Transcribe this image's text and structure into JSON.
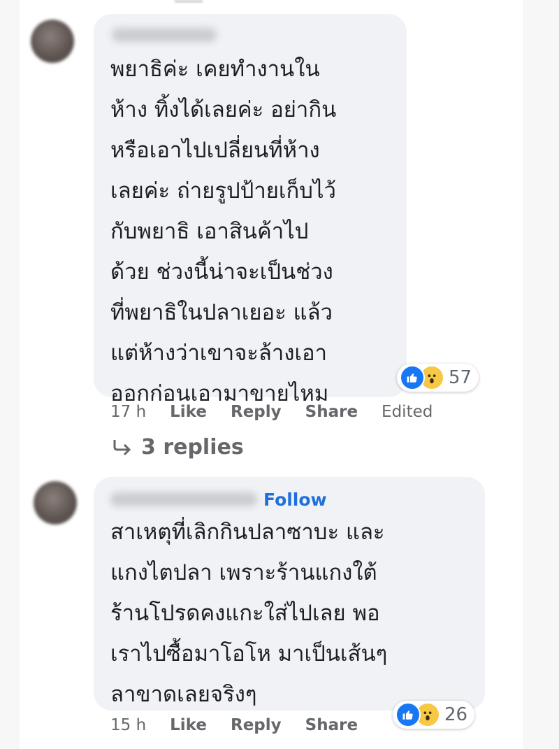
{
  "comments": [
    {
      "text": "พยาธิค่ะ เคยทำงานใน\nห้าง ทิ้งได้เลยค่ะ อย่ากิน\nหรือเอาไปเปลี่ยนที่ห้าง\nเลยค่ะ ถ่ายรูปป้ายเก็บไว้\nกับพยาธิ เอาสินค้าไป\nด้วย ช่วงนี้น่าจะเป็นช่วง\nที่พยาธิในปลาเยอะ แล้ว\nแต่ห้างว่าเขาจะล้างเอา\nออกก่อนเอามาขายไหม",
      "reaction_count": "57",
      "reaction_icons": [
        "like-icon",
        "wow-icon"
      ],
      "time": "17 h",
      "like_label": "Like",
      "reply_label": "Reply",
      "share_label": "Share",
      "edited_label": "Edited",
      "replies_label": "3 replies"
    },
    {
      "follow_label": "Follow",
      "text": "สาเหตุที่เลิกกินปลาซาบะ และ\nแกงไตปลา เพราะร้านแกงใต้\nร้านโปรดคงแกะใส่ไปเลย พอ\nเราไปซื้อมาโอโห มาเป็นเส้นๆ\nลาขาดเลยจริงๆ",
      "reaction_count": "26",
      "reaction_icons": [
        "like-icon",
        "wow-icon"
      ],
      "time": "15 h",
      "like_label": "Like",
      "reply_label": "Reply",
      "share_label": "Share"
    }
  ],
  "colors": {
    "bubble": "#f0f2f5",
    "link_blue": "#216fdb",
    "like_blue": "#1877f2",
    "wow_yellow": "#f7c844",
    "meta_gray": "#65676b"
  }
}
